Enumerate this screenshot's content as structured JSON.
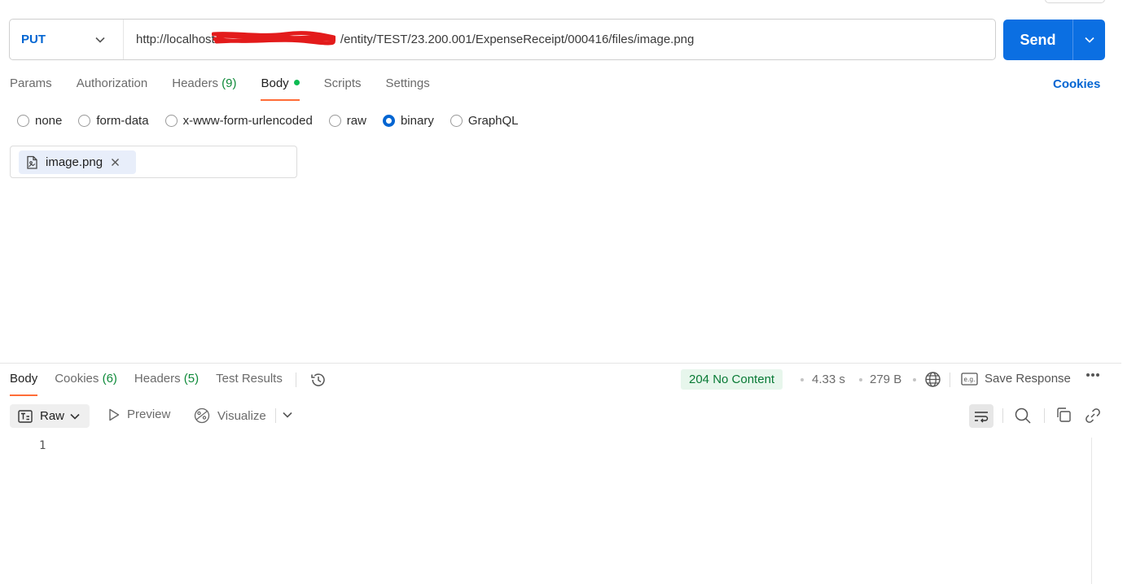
{
  "request": {
    "method": "PUT",
    "url_prefix": "http://localhost/",
    "url_suffix": "/entity/TEST/23.200.001/ExpenseReceipt/000416/files/image.png",
    "send_label": "Send"
  },
  "tabs": {
    "params": "Params",
    "authorization": "Authorization",
    "headers": "Headers",
    "headers_count": "(9)",
    "body": "Body",
    "scripts": "Scripts",
    "settings": "Settings",
    "cookies": "Cookies"
  },
  "body_types": {
    "none": "none",
    "form_data": "form-data",
    "urlencoded": "x-www-form-urlencoded",
    "raw": "raw",
    "binary": "binary",
    "graphql": "GraphQL",
    "selected": "binary"
  },
  "file": {
    "name": "image.png"
  },
  "response": {
    "tabs": {
      "body": "Body",
      "cookies": "Cookies",
      "cookies_count": "(6)",
      "headers": "Headers",
      "headers_count": "(5)",
      "test_results": "Test Results"
    },
    "status": "204 No Content",
    "time": "4.33 s",
    "size": "279 B",
    "save_response": "Save Response",
    "format": "Raw",
    "preview": "Preview",
    "visualize": "Visualize",
    "line_number": "1"
  },
  "colors": {
    "accent": "#0b6fe2",
    "method": "#0265d2",
    "tab_underline": "#ff6c37",
    "status_bg": "#e7f6ec",
    "status_text": "#087a35",
    "redaction": "#e31b1b"
  }
}
